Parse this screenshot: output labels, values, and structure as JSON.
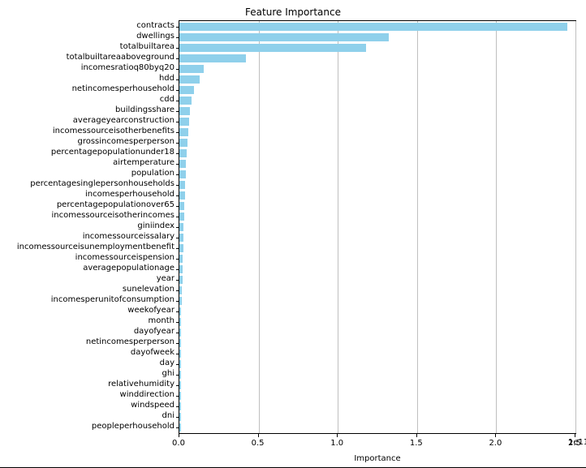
{
  "chart_data": {
    "type": "bar",
    "orientation": "horizontal",
    "title": "Feature Importance",
    "xlabel": "Importance",
    "ylabel": "",
    "xlim": [
      0,
      250000000000.0
    ],
    "x_ticks_raw": [
      0.0,
      50000000000.0,
      100000000000.0,
      150000000000.0,
      200000000000.0,
      250000000000.0
    ],
    "x_tick_labels": [
      "0.0",
      "0.5",
      "1.0",
      "1.5",
      "2.0",
      "2.5"
    ],
    "x_offset_text": "1e11",
    "categories": [
      "contracts",
      "dwellings",
      "totalbuiltarea",
      "totalbuiltareaaboveground",
      "incomesratioq80byq20",
      "hdd",
      "netincomesperhousehold",
      "cdd",
      "buildingsshare",
      "averageyearconstruction",
      "incomessourceisotherbenefits",
      "grossincomesperperson",
      "percentagepopulationunder18",
      "airtemperature",
      "population",
      "percentagesinglepersonhouseholds",
      "incomesperhousehold",
      "percentagepopulationover65",
      "incomessourceisotherincomes",
      "giniindex",
      "incomessourceissalary",
      "incomessourceisunemploymentbenefit",
      "incomessourceispension",
      "averagepopulationage",
      "year",
      "sunelevation",
      "incomesperunitofconsumption",
      "weekofyear",
      "month",
      "dayofyear",
      "netincomesperperson",
      "dayofweek",
      "day",
      "ghi",
      "relativehumidity",
      "winddirection",
      "windspeed",
      "dni",
      "peopleperhousehold"
    ],
    "values": [
      245000000000.0,
      132000000000.0,
      118000000000.0,
      42000000000.0,
      15500000000.0,
      13000000000.0,
      9000000000.0,
      7500000000.0,
      6500000000.0,
      6000000000.0,
      5500000000.0,
      5000000000.0,
      4500000000.0,
      4200000000.0,
      4000000000.0,
      3800000000.0,
      3500000000.0,
      3200000000.0,
      3000000000.0,
      2800000000.0,
      2600000000.0,
      2400000000.0,
      2200000000.0,
      2000000000.0,
      1800000000.0,
      1600000000.0,
      1400000000.0,
      1200000000.0,
      1000000000.0,
      900000000.0,
      800000000.0,
      700000000.0,
      600000000.0,
      500000000.0,
      400000000.0,
      300000000.0,
      200000000.0,
      150000000.0,
      100000000.0
    ],
    "bar_color": "#8fd0eb"
  }
}
